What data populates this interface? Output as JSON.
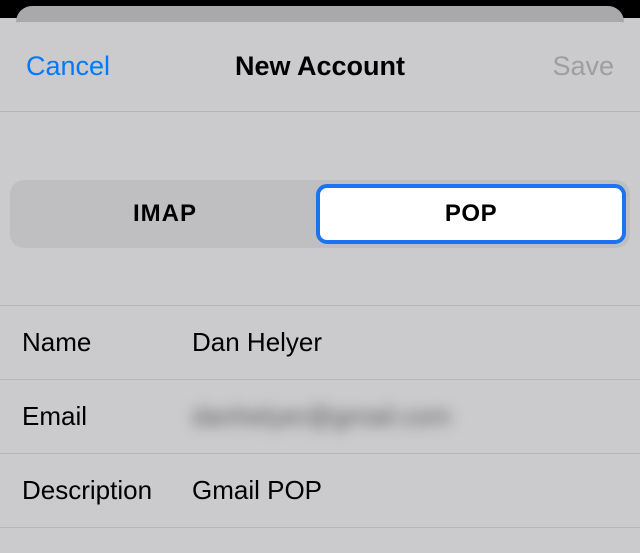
{
  "header": {
    "cancel_label": "Cancel",
    "title": "New Account",
    "save_label": "Save"
  },
  "segmented": {
    "option_a": "IMAP",
    "option_b": "POP"
  },
  "form": {
    "name_label": "Name",
    "name_value": "Dan Helyer",
    "email_label": "Email",
    "email_value": "danhelyer@gmail.com",
    "description_label": "Description",
    "description_value": "Gmail POP"
  }
}
